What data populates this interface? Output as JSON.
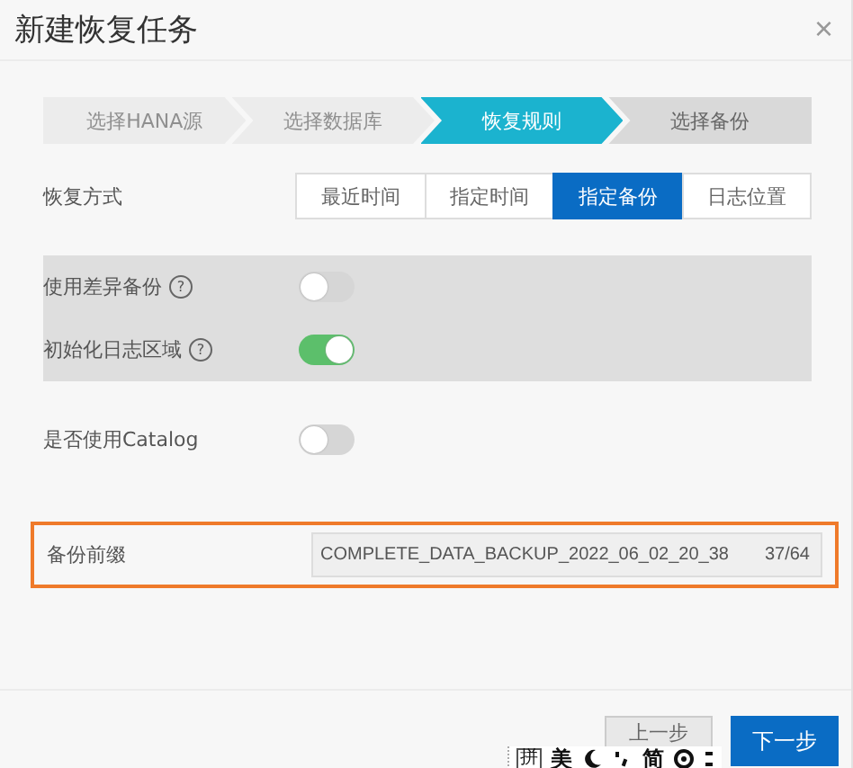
{
  "dialog": {
    "title": "新建恢复任务",
    "close": "×"
  },
  "steps": [
    {
      "label": "选择HANA源",
      "selected": false,
      "completed": true
    },
    {
      "label": "选择数据库",
      "selected": false,
      "completed": true
    },
    {
      "label": "恢复规则",
      "selected": true,
      "completed": false
    },
    {
      "label": "选择备份",
      "selected": false,
      "completed": false
    }
  ],
  "mode": {
    "label": "恢复方式",
    "options": [
      {
        "label": "最近时间",
        "selected": false
      },
      {
        "label": "指定时间",
        "selected": false
      },
      {
        "label": "指定备份",
        "selected": true
      },
      {
        "label": "日志位置",
        "selected": false
      }
    ]
  },
  "switches": [
    {
      "label": "使用差异备份",
      "help": "?",
      "on": false,
      "shaded": true
    },
    {
      "label": "初始化日志区域",
      "help": "?",
      "on": true,
      "shaded": true
    },
    {
      "label": "是否使用Catalog",
      "on": false,
      "shaded": false
    }
  ],
  "prefix": {
    "label": "备份前缀",
    "value": "COMPLETE_DATA_BACKUP_2022_06_02_20_38",
    "count": "37/64",
    "highlighted": true
  },
  "buttons": [
    {
      "label": "上一步",
      "kind": "secondary"
    },
    {
      "label": "下一步",
      "kind": "primary"
    }
  ],
  "ime_toolbar": {
    "items": [
      "拼",
      "美",
      "简"
    ]
  }
}
